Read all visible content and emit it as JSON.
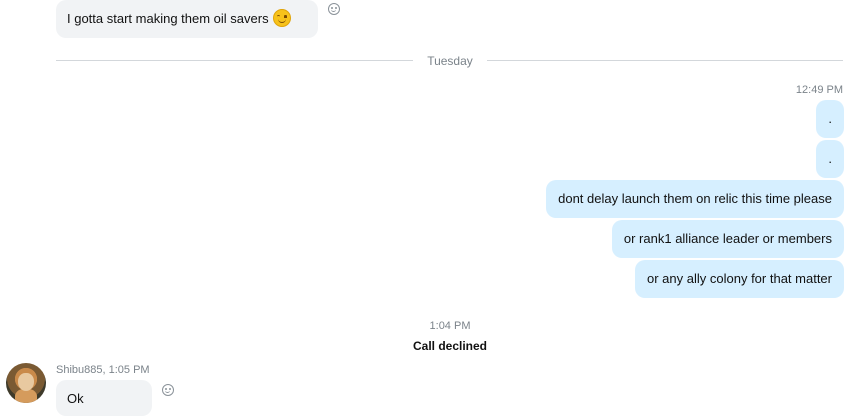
{
  "top_message": {
    "text": "I gotta start making them oil savers",
    "emoji": "smiling-face-icon"
  },
  "day_divider": "Tuesday",
  "outgoing": {
    "timestamp": "12:49 PM",
    "messages": [
      ".",
      ".",
      "dont delay launch them on relic this time please",
      "or rank1 alliance leader or members",
      "or any ally colony for that matter"
    ]
  },
  "call_event": {
    "time": "1:04 PM",
    "label": "Call declined"
  },
  "incoming": {
    "sender_meta": "Shibu885, 1:05 PM",
    "message": "Ok"
  },
  "colors": {
    "outgoing_bubble": "#d6efff",
    "incoming_bubble": "#f1f3f5"
  }
}
